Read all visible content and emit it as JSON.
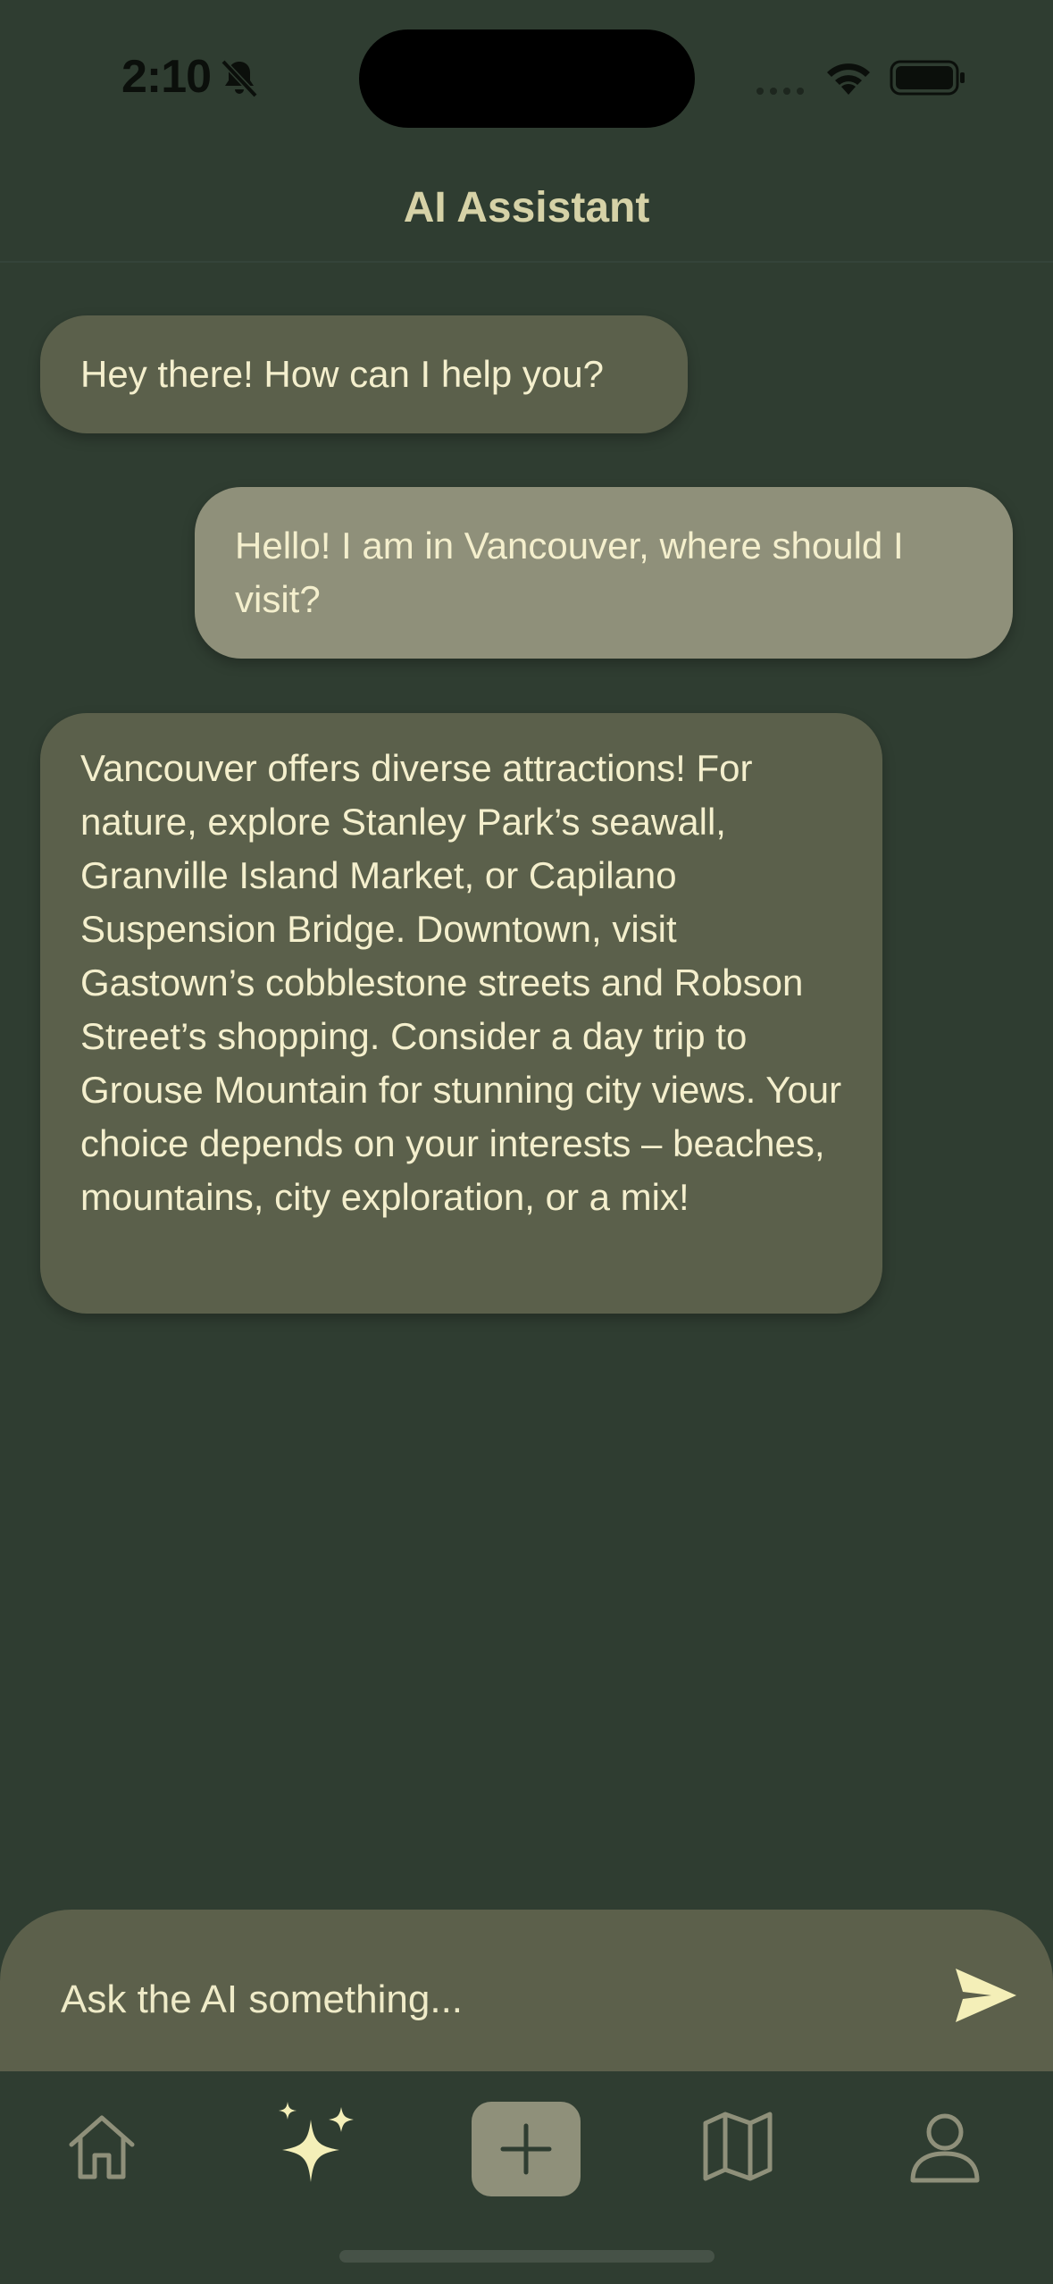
{
  "status_bar": {
    "time": "2:10",
    "icons": [
      "bell-slash-icon",
      "cellular-signal-icon",
      "wifi-icon",
      "battery-icon"
    ]
  },
  "header": {
    "title": "AI Assistant"
  },
  "messages": [
    {
      "role": "assistant",
      "text": "Hey there! How can I help you?"
    },
    {
      "role": "user",
      "text": "Hello! I am in Vancouver, where should I visit?"
    },
    {
      "role": "assistant",
      "text": "Vancouver offers diverse attractions!  For nature, explore Stanley Park’s seawall, Granville Island Market, or Capilano Suspension Bridge.  Downtown, visit Gastown’s cobblestone streets and Robson Street’s shopping.  Consider a day trip to Grouse Mountain for stunning city views.  Your choice depends on your interests –  beaches, mountains, city exploration, or a mix!"
    }
  ],
  "composer": {
    "placeholder": "Ask the AI something...",
    "value": "",
    "send_icon": "paper-plane-send-icon"
  },
  "tab_bar": {
    "items": [
      {
        "name": "home",
        "icon": "house-icon",
        "active": false
      },
      {
        "name": "ai",
        "icon": "sparkles-icon",
        "active": true
      },
      {
        "name": "add",
        "icon": "plus-icon",
        "active": false
      },
      {
        "name": "map",
        "icon": "map-icon",
        "active": false
      },
      {
        "name": "profile",
        "icon": "person-icon",
        "active": false
      }
    ]
  },
  "colors": {
    "background": "#2f3d31",
    "ai_bubble": "#5b604b",
    "user_bubble": "#8f907a",
    "text": "#f4efcd",
    "title": "#d6d2a7",
    "active_icon": "#f4efb8",
    "inactive_icon": "#8f907a"
  }
}
